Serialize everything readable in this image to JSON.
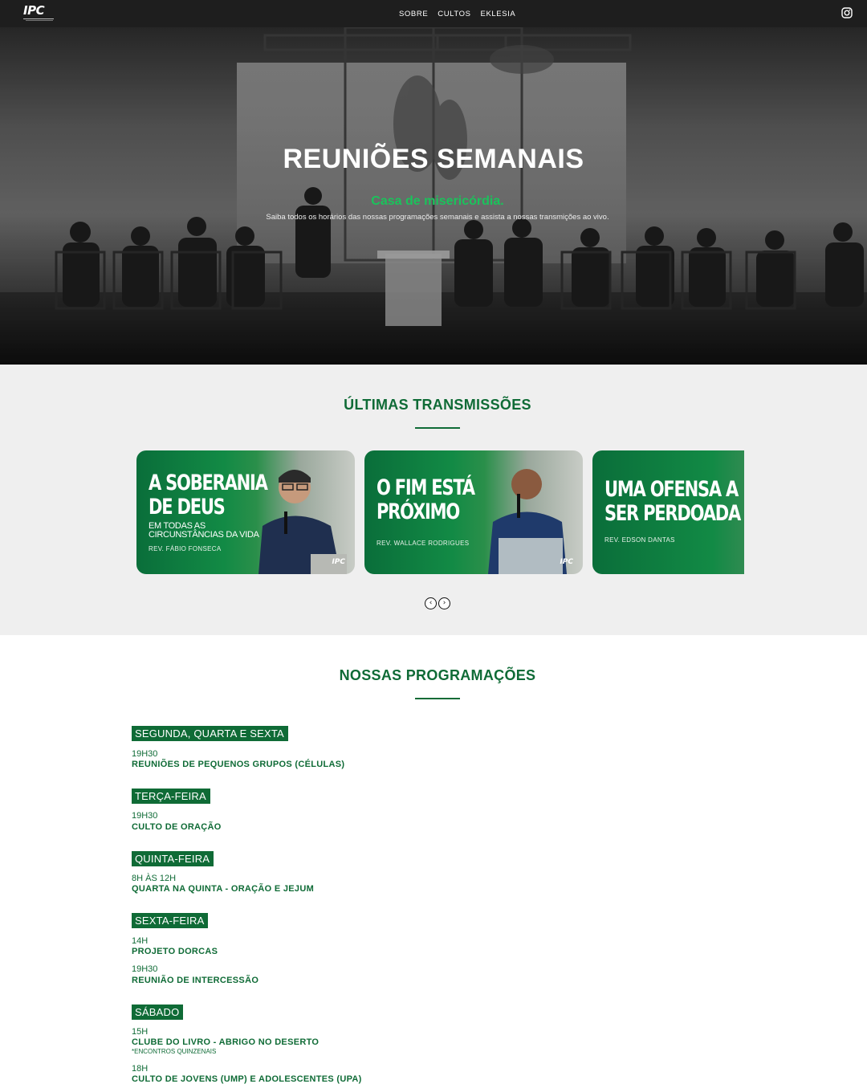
{
  "nav": {
    "logo_text": "IPC",
    "menu": [
      "SOBRE",
      "CULTOS",
      "EKLESIA"
    ],
    "social_icon": "instagram-icon"
  },
  "hero": {
    "title": "REUNIÕES SEMANAIS",
    "subtitle": "Casa de misericórdia.",
    "description": "Saiba todos os horários das nossas programações semanais e assista a nossas transmições ao vivo."
  },
  "transmissions": {
    "title": "ÚLTIMAS TRANSMISSÕES",
    "cards": [
      {
        "title_line1": "A SOBERANIA",
        "title_line2": "DE DEUS",
        "subtitle_line1": "EM TODAS AS",
        "subtitle_line2": "CIRCUNSTÂNCIAS DA VIDA",
        "speaker": "REV. FÁBIO FONSECA",
        "mark": "IPC"
      },
      {
        "title_line1": "O FIM ESTÁ",
        "title_line2": "PRÓXIMO",
        "speaker": "REV. WALLACE RODRIGUES",
        "mark": "IPC"
      },
      {
        "title_line1": "UMA OFENSA A",
        "title_line2": "SER PERDOADA",
        "speaker": "REV. EDSON DANTAS"
      }
    ],
    "prev_icon": "‹",
    "next_icon": "›"
  },
  "programs": {
    "title": "NOSSAS PROGRAMAÇÕES",
    "days": [
      {
        "day": "SEGUNDA, QUARTA E SEXTA",
        "events": [
          {
            "time": "19H30",
            "name": "REUNIÕES DE PEQUENOS GRUPOS (CÉLULAS)"
          }
        ]
      },
      {
        "day": "TERÇA-FEIRA",
        "events": [
          {
            "time": "19H30",
            "name": "CULTO DE ORAÇÃO"
          }
        ]
      },
      {
        "day": "QUINTA-FEIRA",
        "events": [
          {
            "time": "8H ÀS 12H",
            "name": "QUARTA NA QUINTA - ORAÇÃO E JEJUM"
          }
        ]
      },
      {
        "day": "SEXTA-FEIRA",
        "events": [
          {
            "time": "14H",
            "name": "PROJETO DORCAS"
          },
          {
            "time": "19H30",
            "name": "REUNIÃO DE INTERCESSÃO"
          }
        ]
      },
      {
        "day": "SÁBADO",
        "events": [
          {
            "time": "15H",
            "name": "CLUBE DO LIVRO - ABRIGO NO DESERTO",
            "note": "*ENCONTROS QUINZENAIS"
          },
          {
            "time": "18H",
            "name": "CULTO DE JOVENS (UMP) E ADOLESCENTES (UPA)"
          }
        ]
      }
    ]
  },
  "colors": {
    "brand_green": "#0f6b36",
    "accent_green": "#1ac35b",
    "nav_bg": "#1e1e1e",
    "section_bg": "#efefef"
  }
}
